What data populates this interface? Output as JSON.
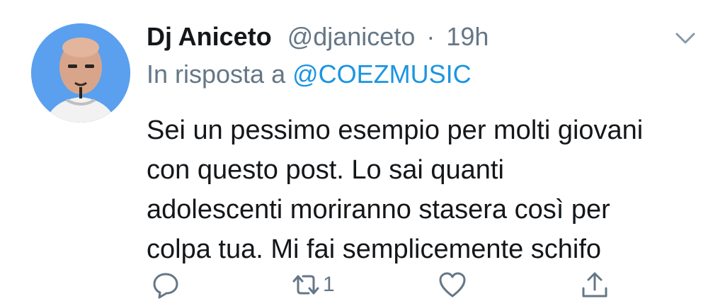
{
  "tweet": {
    "display_name": "Dj Aniceto",
    "handle": "@djaniceto",
    "separator": "·",
    "time": "19h",
    "reply_prefix": "In risposta a",
    "reply_to": "@COEZMUSIC",
    "text_lines": [
      "Sei un pessimo esempio per molti giovani",
      "con questo post. Lo sai quanti",
      "adolescenti moriranno stasera così per",
      "colpa tua. Mi fai semplicemente schifo"
    ],
    "retweet_count": "1"
  },
  "icons": {
    "reply": "reply-icon",
    "retweet": "retweet-icon",
    "like": "heart-icon",
    "share": "share-icon",
    "more": "chevron-down-icon"
  },
  "colors": {
    "text": "#14171a",
    "secondary": "#657786",
    "link": "#1b95e0",
    "avatar_bg": "#5aa0ee"
  }
}
